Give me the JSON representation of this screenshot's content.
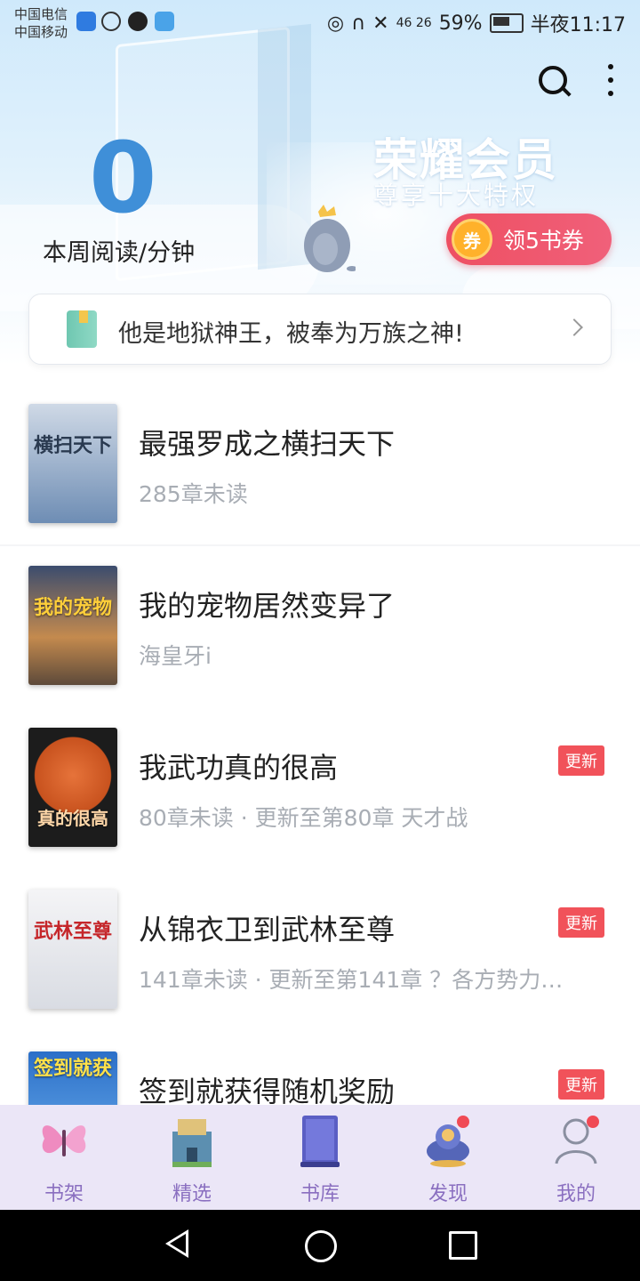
{
  "status_bar": {
    "carrier1": "中国电信",
    "carrier2": "中国移动",
    "network": "46 26",
    "battery": "59%",
    "time": "半夜11:17"
  },
  "header": {
    "reading_minutes": "0",
    "reading_label": "本周阅读/分钟",
    "vip_title": "荣耀会员",
    "vip_subtitle": "尊享十大特权",
    "coupon_icon_text": "券",
    "coupon_label": "领5书券"
  },
  "notice": {
    "text": "他是地狱神王，被奉为万族之神!"
  },
  "books": [
    {
      "title": "最强罗成之横扫天下",
      "sub": "285章未读",
      "badge": "",
      "cover_text": "横扫天下",
      "cover_color": "#7f9cc0"
    },
    {
      "title": "我的宠物居然变异了",
      "sub": "海皇牙i",
      "badge": "",
      "cover_text": "我的宠物",
      "cover_color": "#b58a5e"
    },
    {
      "title": "我武功真的很高",
      "sub": "80章未读 · 更新至第80章  天才战",
      "badge": "更新",
      "cover_text": "真的很高",
      "cover_color": "#d86a2a"
    },
    {
      "title": "从锦衣卫到武林至尊",
      "sub": "141章未读 · 更新至第141章 ？各方势力…",
      "badge": "更新",
      "cover_text": "武林至尊",
      "cover_color": "#e9e9ee"
    },
    {
      "title": "签到就获得随机奖励",
      "sub": "",
      "badge": "更新",
      "cover_text": "签到就获",
      "cover_color": "#3a7fd0"
    }
  ],
  "nav": {
    "items": [
      {
        "label": "书架",
        "icon": "butterfly-icon"
      },
      {
        "label": "精选",
        "icon": "castle-icon"
      },
      {
        "label": "书库",
        "icon": "book-icon"
      },
      {
        "label": "发现",
        "icon": "genie-lamp-icon"
      },
      {
        "label": "我的",
        "icon": "person-icon"
      }
    ]
  },
  "colors": {
    "accent_blue": "#3f8fd8",
    "badge_red": "#f1525a",
    "nav_bg": "#ebe6f7",
    "nav_text": "#8a6fc0"
  }
}
